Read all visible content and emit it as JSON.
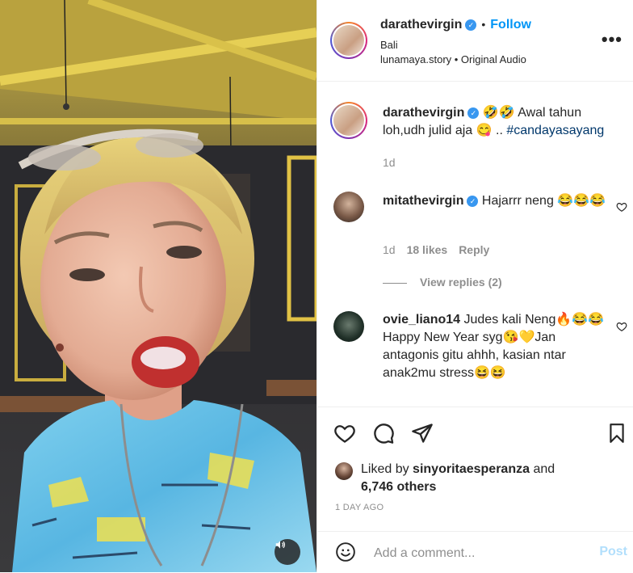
{
  "post": {
    "username": "darathevirgin",
    "follow_label": "Follow",
    "location": "Bali",
    "audio_text": "lunamaya.story • Original Audio",
    "more_label": "•••"
  },
  "caption": {
    "username": "darathevirgin",
    "text": " 🤣🤣 Awal tahun loh,udh julid aja 😋 .. ",
    "hashtag": "#candayasayang",
    "time": "1d"
  },
  "comments": [
    {
      "username": "mitathevirgin",
      "text": " Hajarrr neng 😂😂😂",
      "time": "1d",
      "likes": "18 likes",
      "reply_label": "Reply"
    },
    {
      "username": "ovie_liano14",
      "text": " Judes kali Neng🔥😂😂 Happy New Year syg😘💛Jan antagonis gitu ahhh, kasian ntar anak2mu stress😆😆",
      "time": "",
      "likes": "",
      "reply_label": ""
    }
  ],
  "view_replies_label": "View replies (2)",
  "liked_by": {
    "prefix": "Liked by ",
    "user": "sinyoritaesperanza",
    "middle": " and",
    "others": "6,746 others"
  },
  "time_ago": "1 DAY AGO",
  "comment_input": {
    "placeholder": "Add a comment...",
    "post_label": "Post"
  },
  "colors": {
    "accent": "#0095f6",
    "verified": "#3897f0",
    "post_disabled": "#b2dffc"
  }
}
